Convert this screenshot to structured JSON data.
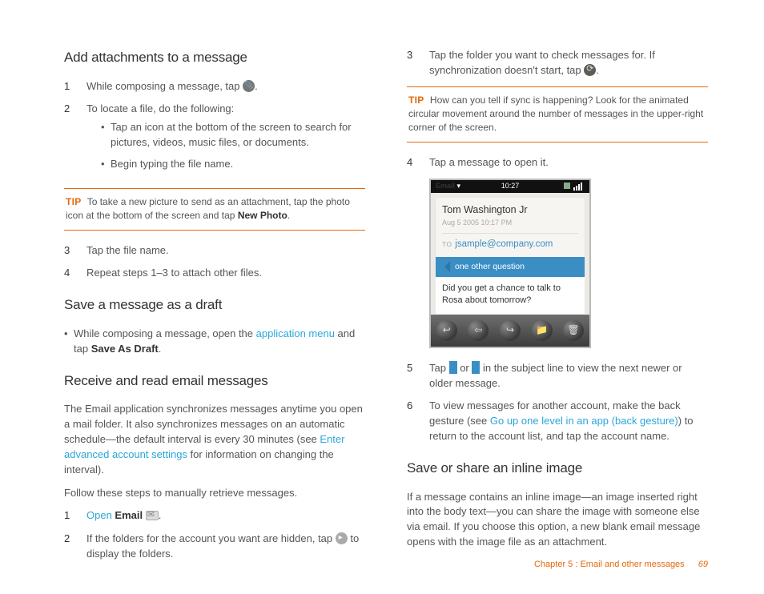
{
  "col1": {
    "h_attach": "Add attachments to a message",
    "s1_num": "1",
    "s1_pre": "While composing a message, tap ",
    "s1_post": ".",
    "s2_num": "2",
    "s2": "To locate a file, do the following:",
    "s2_b1": "Tap an icon at the bottom of the screen to search for pictures, videos, music files, or documents.",
    "s2_b2": "Begin typing the file name.",
    "tip1_pre": "To take a new picture to send as an attachment, tap the photo icon at the bottom of the screen and tap ",
    "tip1_bold": "New Photo",
    "s3_num": "3",
    "s3": "Tap the file name.",
    "s4_num": "4",
    "s4": "Repeat steps 1–3 to attach other files.",
    "h_draft": "Save a message as a draft",
    "draft_pre": "While composing a message, open the ",
    "draft_link": "application menu",
    "draft_mid": " and tap ",
    "draft_bold": "Save As Draft",
    "draft_post": ".",
    "h_receive": "Receive and read email messages",
    "rcv_p1_a": "The Email application synchronizes messages anytime you open a mail folder. It also synchronizes messages on an automatic schedule—the default interval is every 30 minutes (see ",
    "rcv_p1_link": "Enter advanced account settings",
    "rcv_p1_b": " for information on changing the interval).",
    "rcv_p2": "Follow these steps to manually retrieve messages.",
    "r1_num": "1",
    "r1_open": "Open",
    "r1_email": " Email ",
    "r2_num": "2",
    "r2_pre": "If the folders for the account you want are hidden, tap ",
    "r2_post": " to display the folders."
  },
  "col2": {
    "r3_num": "3",
    "r3_pre": "Tap the folder you want to check messages for. If synchronization doesn't start, tap ",
    "r3_post": ".",
    "tip2": "How can you tell if sync is happening? Look for the animated circular movement around the number of messages in the upper-right corner of the screen.",
    "r4_num": "4",
    "r4": "Tap a message to open it.",
    "phone": {
      "status_left": "Email",
      "status_mid": "10:27",
      "sender": "Tom Washington Jr",
      "date": "Aug 5 2005 10:17 PM",
      "to_label": "TO",
      "to_email": "jsample@company.com",
      "subject": "one other question",
      "body": "Did you get a chance to talk to Rosa about tomorrow?"
    },
    "r5_num": "5",
    "r5_pre": "Tap ",
    "r5_mid": " or ",
    "r5_post": " in the subject line to view the next newer or older message.",
    "r6_num": "6",
    "r6_pre": "To view messages for another account, make the back gesture (see ",
    "r6_link": "Go up one level in an app (back gesture)",
    "r6_post": ") to return to the account list, and tap the account name.",
    "h_inline": "Save or share an inline image",
    "inline_p": "If a message contains an inline image—an image inserted right into the body text—you can share the image with someone else via email. If you choose this option, a new blank email message opens with the image file as an attachment."
  },
  "labels": {
    "tip": "TIP"
  },
  "footer": {
    "text": "Chapter 5 : Email and other messages",
    "page": "69"
  }
}
